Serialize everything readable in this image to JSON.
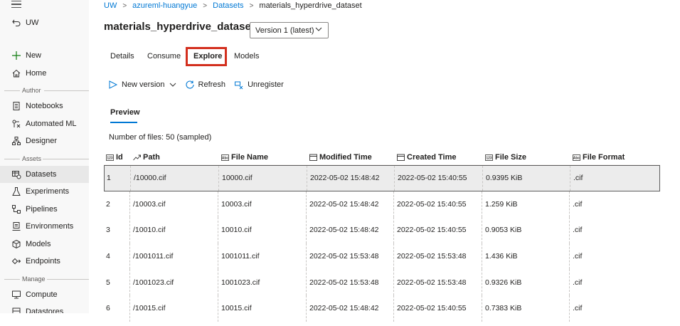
{
  "sidebar": {
    "workspace": "UW",
    "items": [
      {
        "label": "New"
      },
      {
        "label": "Home"
      },
      {
        "label": "Notebooks"
      },
      {
        "label": "Automated ML"
      },
      {
        "label": "Designer"
      },
      {
        "label": "Datasets"
      },
      {
        "label": "Experiments"
      },
      {
        "label": "Pipelines"
      },
      {
        "label": "Environments"
      },
      {
        "label": "Models"
      },
      {
        "label": "Endpoints"
      },
      {
        "label": "Compute"
      },
      {
        "label": "Datastores"
      }
    ],
    "sections": {
      "author": "Author",
      "assets": "Assets",
      "manage": "Manage"
    }
  },
  "breadcrumb": [
    "UW",
    "azureml-huangyue",
    "Datasets",
    "materials_hyperdrive_dataset"
  ],
  "page": {
    "title": "materials_hyperdrive_dataset",
    "version": "Version 1 (latest)"
  },
  "tabs": [
    "Details",
    "Consume",
    "Explore",
    "Models"
  ],
  "commands": {
    "new_version": "New version",
    "refresh": "Refresh",
    "unregister": "Unregister"
  },
  "subtab": "Preview",
  "file_count": "Number of files:  50 (sampled)",
  "table": {
    "columns": [
      "Id",
      "Path",
      "File Name",
      "Modified Time",
      "Created Time",
      "File Size",
      "File Format"
    ],
    "rows": [
      [
        "1",
        "/10000.cif",
        "10000.cif",
        "2022-05-02 15:48:42",
        "2022-05-02 15:40:55",
        "0.9395 KiB",
        ".cif"
      ],
      [
        "2",
        "/10003.cif",
        "10003.cif",
        "2022-05-02 15:48:42",
        "2022-05-02 15:40:55",
        "1.259 KiB",
        ".cif"
      ],
      [
        "3",
        "/10010.cif",
        "10010.cif",
        "2022-05-02 15:48:42",
        "2022-05-02 15:40:55",
        "0.9053 KiB",
        ".cif"
      ],
      [
        "4",
        "/1001011.cif",
        "1001011.cif",
        "2022-05-02 15:53:48",
        "2022-05-02 15:53:48",
        "1.436 KiB",
        ".cif"
      ],
      [
        "5",
        "/1001023.cif",
        "1001023.cif",
        "2022-05-02 15:53:48",
        "2022-05-02 15:53:48",
        "0.9326 KiB",
        ".cif"
      ],
      [
        "6",
        "/10015.cif",
        "10015.cif",
        "2022-05-02 15:48:42",
        "2022-05-02 15:40:55",
        "0.7383 KiB",
        ".cif"
      ]
    ]
  },
  "colors": {
    "accent": "#0078d4",
    "highlight": "#d32f1e"
  }
}
